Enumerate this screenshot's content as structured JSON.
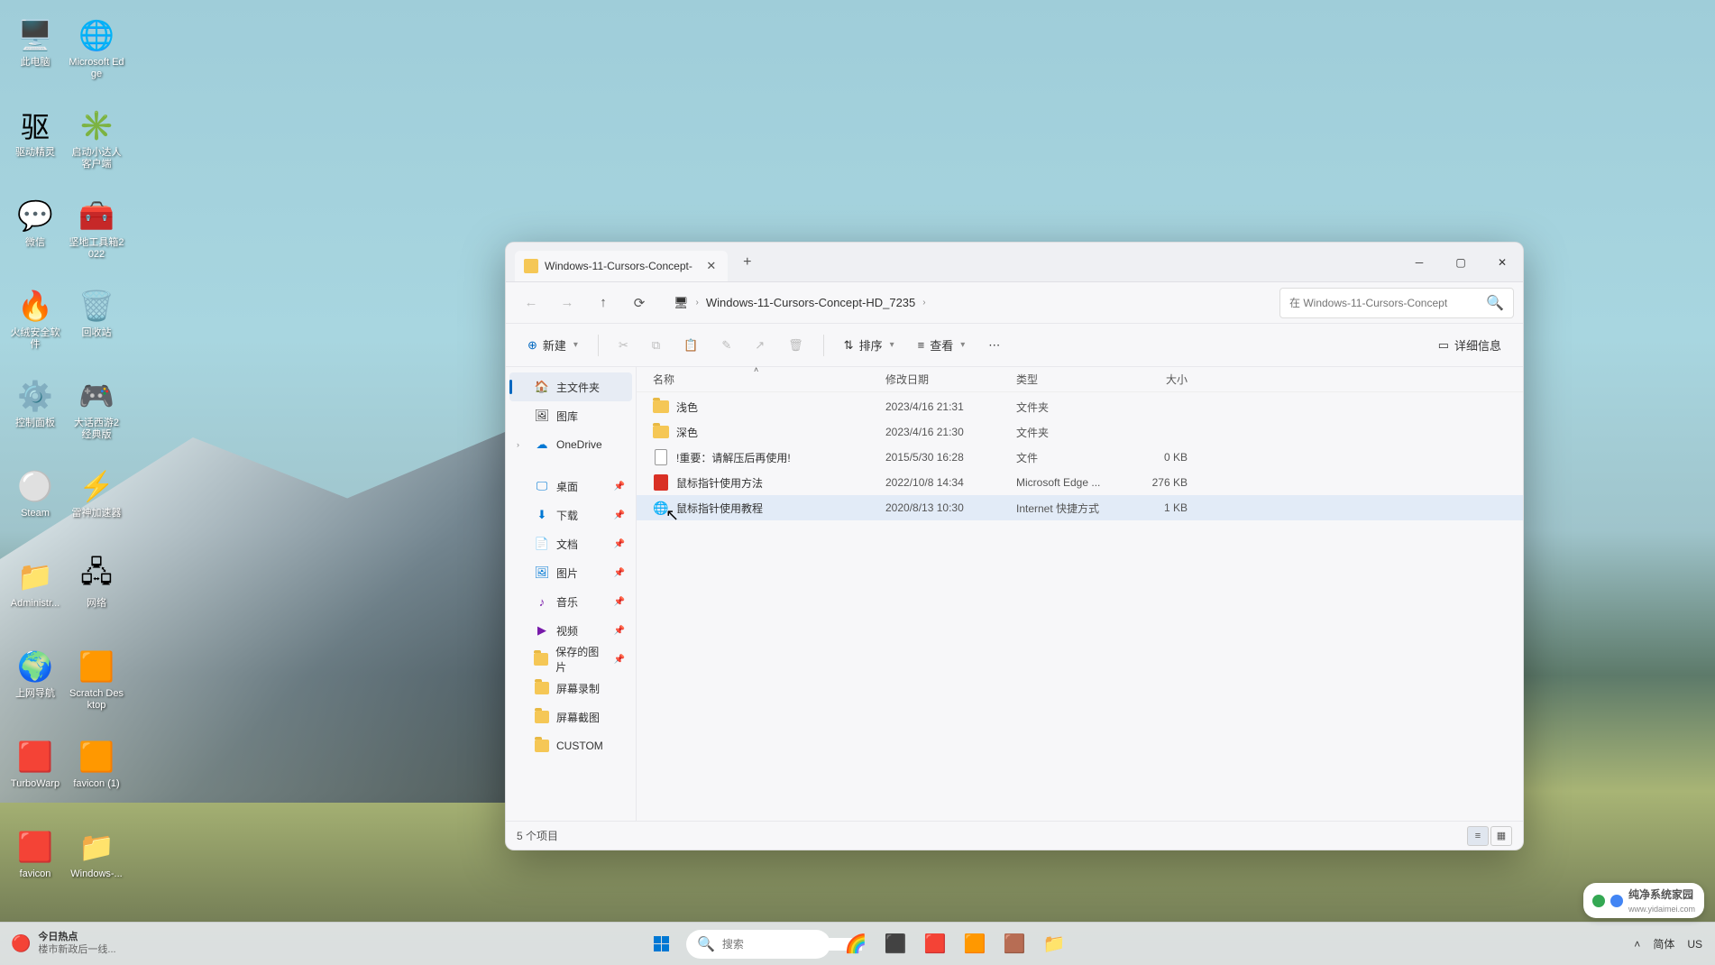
{
  "desktop": {
    "icons": [
      {
        "label": "此电脑",
        "glyph": "🖥️"
      },
      {
        "label": "Microsoft Edge",
        "glyph": "🌐"
      },
      {
        "label": "驱动精灵",
        "glyph": "驱"
      },
      {
        "label": "启动小达人客户端",
        "glyph": "✳️"
      },
      {
        "label": "微信",
        "glyph": "💬"
      },
      {
        "label": "坚地工具箱2022",
        "glyph": "🧰"
      },
      {
        "label": "火绒安全软件",
        "glyph": "🔥"
      },
      {
        "label": "回收站",
        "glyph": "🗑️"
      },
      {
        "label": "控制面板",
        "glyph": "⚙️"
      },
      {
        "label": "大话西游2 经典版",
        "glyph": "🎮"
      },
      {
        "label": "Steam",
        "glyph": "⚪"
      },
      {
        "label": "雷神加速器",
        "glyph": "⚡"
      },
      {
        "label": "Administr...",
        "glyph": "📁"
      },
      {
        "label": "网络",
        "glyph": "🖧"
      },
      {
        "label": "上网导航",
        "glyph": "🌍"
      },
      {
        "label": "Scratch Desktop",
        "glyph": "🟧"
      },
      {
        "label": "TurboWarp",
        "glyph": "🟥"
      },
      {
        "label": "favicon (1)",
        "glyph": "🟧"
      },
      {
        "label": "favicon",
        "glyph": "🟥"
      },
      {
        "label": "Windows-...",
        "glyph": "📁"
      }
    ]
  },
  "explorer": {
    "tab_title": "Windows-11-Cursors-Concept-",
    "breadcrumb": "Windows-11-Cursors-Concept-HD_7235",
    "search_placeholder": "在 Windows-11-Cursors-Concept",
    "toolbar": {
      "new": "新建",
      "sort": "排序",
      "view": "查看",
      "details": "详细信息"
    },
    "sidebar": {
      "home": "主文件夹",
      "gallery": "图库",
      "onedrive": "OneDrive",
      "desktop": "桌面",
      "downloads": "下载",
      "documents": "文档",
      "pictures": "图片",
      "music": "音乐",
      "videos": "视频",
      "saved_pics": "保存的图片",
      "screenrec": "屏幕录制",
      "screenshots": "屏幕截图",
      "custom": "CUSTOM"
    },
    "columns": {
      "name": "名称",
      "date": "修改日期",
      "type": "类型",
      "size": "大小"
    },
    "files": [
      {
        "name": "浅色",
        "date": "2023/4/16 21:31",
        "type": "文件夹",
        "size": "",
        "icon": "folder"
      },
      {
        "name": "深色",
        "date": "2023/4/16 21:30",
        "type": "文件夹",
        "size": "",
        "icon": "folder"
      },
      {
        "name": "!重要：请解压后再使用!",
        "date": "2015/5/30 16:28",
        "type": "文件",
        "size": "0 KB",
        "icon": "file"
      },
      {
        "name": "鼠标指针使用方法",
        "date": "2022/10/8 14:34",
        "type": "Microsoft Edge ...",
        "size": "276 KB",
        "icon": "pdf"
      },
      {
        "name": "鼠标指针使用教程",
        "date": "2020/8/13 10:30",
        "type": "Internet 快捷方式",
        "size": "1 KB",
        "icon": "link",
        "hover": true
      }
    ],
    "status": "5 个项目"
  },
  "taskbar": {
    "widget_title": "今日热点",
    "widget_sub": "楼市新政后一线...",
    "search": "搜索",
    "ime_lang": "简体",
    "ime_kbd": "US"
  },
  "watermark": {
    "brand": "纯净系统家园",
    "url": "www.yidaimei.com"
  }
}
